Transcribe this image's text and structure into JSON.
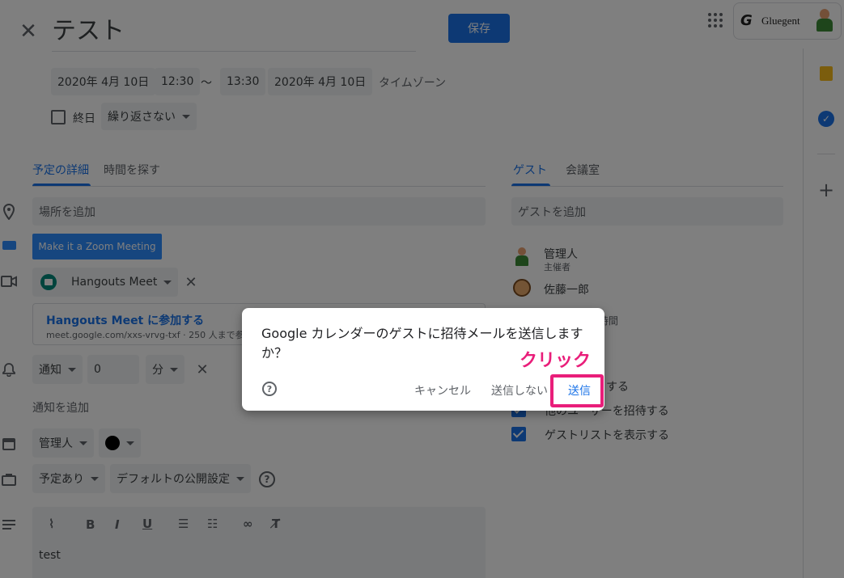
{
  "header": {
    "title": "テスト",
    "save_label": "保存",
    "brand": "Gluegent"
  },
  "datetime": {
    "start_date": "2020年 4月 10日",
    "start_time": "12:30",
    "separator": "〜",
    "end_time": "13:30",
    "end_date": "2020年 4月 10日",
    "timezone": "タイムゾーン",
    "all_day": "終日",
    "repeat": "繰り返さない"
  },
  "details": {
    "tabs": [
      "予定の詳細",
      "時間を探す"
    ],
    "location_placeholder": "場所を追加",
    "zoom_button": "Make it a Zoom Meeting",
    "conference": "Hangouts Meet",
    "meet_title": "Hangouts Meet に参加する",
    "meet_sub": "meet.google.com/xxs-vrvg-txf · 250 人まで参加",
    "notify_type": "通知",
    "notify_value": "0",
    "notify_unit": "分",
    "add_notification": "通知を追加",
    "calendar_owner": "管理人",
    "busy": "予定あり",
    "visibility": "デフォルトの公開設定",
    "description": "test"
  },
  "guests": {
    "tabs": [
      "ゲスト",
      "会議室"
    ],
    "add_placeholder": "ゲストを追加",
    "list": [
      {
        "name": "管理人",
        "role": "主催者"
      },
      {
        "name": "佐藤一郎",
        "role": ""
      }
    ],
    "partial_time": "時間",
    "perm_edit": "する",
    "perm_invite": "他のユーザーを招待する",
    "perm_see": "ゲストリストを表示する"
  },
  "dialog": {
    "message": "Google カレンダーのゲストに招待メールを送信しますか？",
    "cancel": "キャンセル",
    "dont_send": "送信しない",
    "send": "送信"
  },
  "annotation": {
    "label": "クリック"
  },
  "colors": {
    "accent": "#1a73e8",
    "annotation": "#e91e7a",
    "zoom_button": "#2d8cff"
  }
}
